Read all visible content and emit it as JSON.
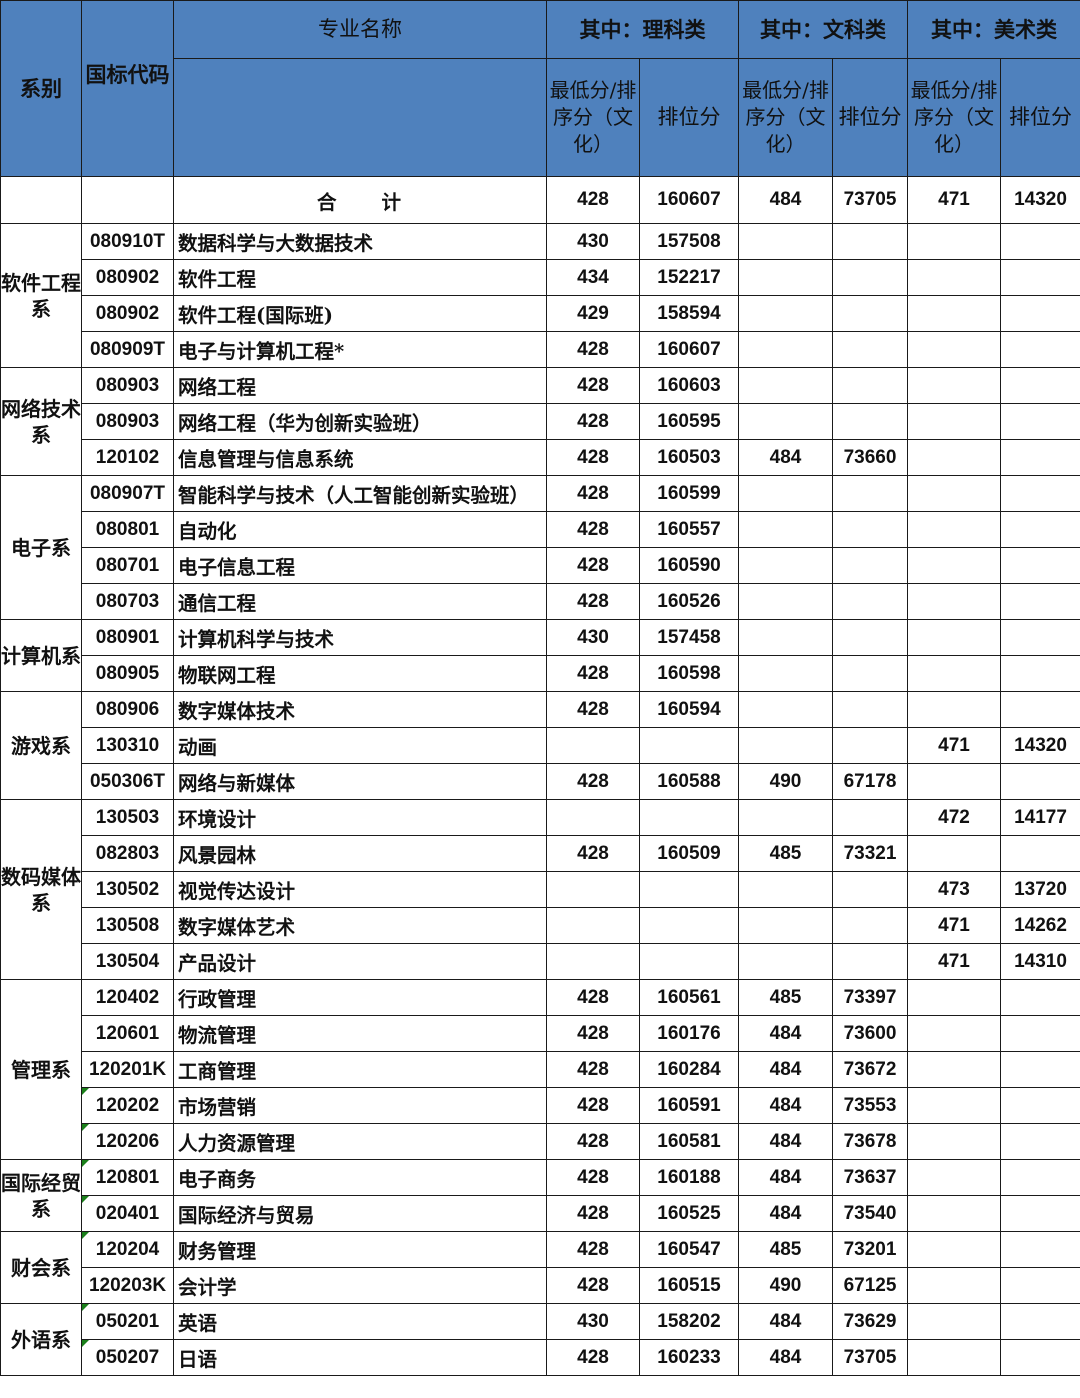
{
  "header": {
    "dept": "系别",
    "code": "国标代码",
    "major": "专业名称",
    "science": "其中：理科类",
    "arts": "其中：文科类",
    "fine_arts": "其中：美术类",
    "min_score": "最低分/排序分（文化）",
    "rank": "排位分",
    "rank_short": "排位分"
  },
  "total": {
    "label": "合　　计",
    "sci_min": "428",
    "sci_rank": "160607",
    "arts_min": "484",
    "arts_rank": "73705",
    "fine_min": "471",
    "fine_rank": "14320"
  },
  "groups": [
    {
      "dept": "软件工程系",
      "rows": [
        {
          "code": "080910T",
          "major": "数据科学与大数据技术",
          "sci_min": "430",
          "sci_rank": "157508",
          "arts_min": "",
          "arts_rank": "",
          "fine_min": "",
          "fine_rank": ""
        },
        {
          "code": "080902",
          "major": "软件工程",
          "sci_min": "434",
          "sci_rank": "152217",
          "arts_min": "",
          "arts_rank": "",
          "fine_min": "",
          "fine_rank": ""
        },
        {
          "code": "080902",
          "major": "软件工程(国际班)",
          "sci_min": "429",
          "sci_rank": "158594",
          "arts_min": "",
          "arts_rank": "",
          "fine_min": "",
          "fine_rank": ""
        },
        {
          "code": "080909T",
          "major": "电子与计算机工程*",
          "sci_min": "428",
          "sci_rank": "160607",
          "arts_min": "",
          "arts_rank": "",
          "fine_min": "",
          "fine_rank": ""
        }
      ]
    },
    {
      "dept": "网络技术系",
      "rows": [
        {
          "code": "080903",
          "major": "网络工程",
          "sci_min": "428",
          "sci_rank": "160603",
          "arts_min": "",
          "arts_rank": "",
          "fine_min": "",
          "fine_rank": ""
        },
        {
          "code": "080903",
          "major": "网络工程（华为创新实验班）",
          "sci_min": "428",
          "sci_rank": "160595",
          "arts_min": "",
          "arts_rank": "",
          "fine_min": "",
          "fine_rank": ""
        },
        {
          "code": "120102",
          "major": "信息管理与信息系统",
          "sci_min": "428",
          "sci_rank": "160503",
          "arts_min": "484",
          "arts_rank": "73660",
          "fine_min": "",
          "fine_rank": ""
        }
      ]
    },
    {
      "dept": "电子系",
      "rows": [
        {
          "code": "080907T",
          "major": "智能科学与技术（人工智能创新实验班）",
          "sci_min": "428",
          "sci_rank": "160599",
          "arts_min": "",
          "arts_rank": "",
          "fine_min": "",
          "fine_rank": ""
        },
        {
          "code": "080801",
          "major": "自动化",
          "sci_min": "428",
          "sci_rank": "160557",
          "arts_min": "",
          "arts_rank": "",
          "fine_min": "",
          "fine_rank": ""
        },
        {
          "code": "080701",
          "major": "电子信息工程",
          "sci_min": "428",
          "sci_rank": "160590",
          "arts_min": "",
          "arts_rank": "",
          "fine_min": "",
          "fine_rank": ""
        },
        {
          "code": "080703",
          "major": "通信工程",
          "sci_min": "428",
          "sci_rank": "160526",
          "arts_min": "",
          "arts_rank": "",
          "fine_min": "",
          "fine_rank": ""
        }
      ]
    },
    {
      "dept": "计算机系",
      "rows": [
        {
          "code": "080901",
          "major": "计算机科学与技术",
          "sci_min": "430",
          "sci_rank": "157458",
          "arts_min": "",
          "arts_rank": "",
          "fine_min": "",
          "fine_rank": ""
        },
        {
          "code": "080905",
          "major": "物联网工程",
          "sci_min": "428",
          "sci_rank": "160598",
          "arts_min": "",
          "arts_rank": "",
          "fine_min": "",
          "fine_rank": ""
        }
      ]
    },
    {
      "dept": "游戏系",
      "rows": [
        {
          "code": "080906",
          "major": "数字媒体技术",
          "sci_min": "428",
          "sci_rank": "160594",
          "arts_min": "",
          "arts_rank": "",
          "fine_min": "",
          "fine_rank": ""
        },
        {
          "code": "130310",
          "major": "动画",
          "sci_min": "",
          "sci_rank": "",
          "arts_min": "",
          "arts_rank": "",
          "fine_min": "471",
          "fine_rank": "14320"
        },
        {
          "code": "050306T",
          "major": "网络与新媒体",
          "sci_min": "428",
          "sci_rank": "160588",
          "arts_min": "490",
          "arts_rank": "67178",
          "fine_min": "",
          "fine_rank": ""
        }
      ]
    },
    {
      "dept": "数码媒体系",
      "rows": [
        {
          "code": "130503",
          "major": "环境设计",
          "sci_min": "",
          "sci_rank": "",
          "arts_min": "",
          "arts_rank": "",
          "fine_min": "472",
          "fine_rank": "14177"
        },
        {
          "code": "082803",
          "major": "风景园林",
          "sci_min": "428",
          "sci_rank": "160509",
          "arts_min": "485",
          "arts_rank": "73321",
          "fine_min": "",
          "fine_rank": ""
        },
        {
          "code": "130502",
          "major": "视觉传达设计",
          "sci_min": "",
          "sci_rank": "",
          "arts_min": "",
          "arts_rank": "",
          "fine_min": "473",
          "fine_rank": "13720"
        },
        {
          "code": "130508",
          "major": "数字媒体艺术",
          "sci_min": "",
          "sci_rank": "",
          "arts_min": "",
          "arts_rank": "",
          "fine_min": "471",
          "fine_rank": "14262"
        },
        {
          "code": "130504",
          "major": "产品设计",
          "sci_min": "",
          "sci_rank": "",
          "arts_min": "",
          "arts_rank": "",
          "fine_min": "471",
          "fine_rank": "14310"
        }
      ]
    },
    {
      "dept": "管理系",
      "rows": [
        {
          "code": "120402",
          "major": "行政管理",
          "sci_min": "428",
          "sci_rank": "160561",
          "arts_min": "485",
          "arts_rank": "73397",
          "fine_min": "",
          "fine_rank": ""
        },
        {
          "code": "120601",
          "major": "物流管理",
          "sci_min": "428",
          "sci_rank": "160176",
          "arts_min": "484",
          "arts_rank": "73600",
          "fine_min": "",
          "fine_rank": ""
        },
        {
          "code": "120201K",
          "major": "工商管理",
          "sci_min": "428",
          "sci_rank": "160284",
          "arts_min": "484",
          "arts_rank": "73672",
          "fine_min": "",
          "fine_rank": ""
        },
        {
          "code": "120202",
          "major": "市场营销",
          "sci_min": "428",
          "sci_rank": "160591",
          "arts_min": "484",
          "arts_rank": "73553",
          "fine_min": "",
          "fine_rank": "",
          "flag": true
        },
        {
          "code": "120206",
          "major": "人力资源管理",
          "sci_min": "428",
          "sci_rank": "160581",
          "arts_min": "484",
          "arts_rank": "73678",
          "fine_min": "",
          "fine_rank": "",
          "flag": true
        }
      ]
    },
    {
      "dept": "国际经贸系",
      "rows": [
        {
          "code": "120801",
          "major": "电子商务",
          "sci_min": "428",
          "sci_rank": "160188",
          "arts_min": "484",
          "arts_rank": "73637",
          "fine_min": "",
          "fine_rank": "",
          "flag": true
        },
        {
          "code": "020401",
          "major": "国际经济与贸易",
          "sci_min": "428",
          "sci_rank": "160525",
          "arts_min": "484",
          "arts_rank": "73540",
          "fine_min": "",
          "fine_rank": "",
          "flag": true
        }
      ]
    },
    {
      "dept": "财会系",
      "rows": [
        {
          "code": "120204",
          "major": "财务管理",
          "sci_min": "428",
          "sci_rank": "160547",
          "arts_min": "485",
          "arts_rank": "73201",
          "fine_min": "",
          "fine_rank": "",
          "flag": true
        },
        {
          "code": "120203K",
          "major": "会计学",
          "sci_min": "428",
          "sci_rank": "160515",
          "arts_min": "490",
          "arts_rank": "67125",
          "fine_min": "",
          "fine_rank": ""
        }
      ]
    },
    {
      "dept": "外语系",
      "rows": [
        {
          "code": "050201",
          "major": "英语",
          "sci_min": "430",
          "sci_rank": "158202",
          "arts_min": "484",
          "arts_rank": "73629",
          "fine_min": "",
          "fine_rank": "",
          "flag": true
        },
        {
          "code": "050207",
          "major": "日语",
          "sci_min": "428",
          "sci_rank": "160233",
          "arts_min": "484",
          "arts_rank": "73705",
          "fine_min": "",
          "fine_rank": "",
          "flag": true
        }
      ]
    }
  ]
}
